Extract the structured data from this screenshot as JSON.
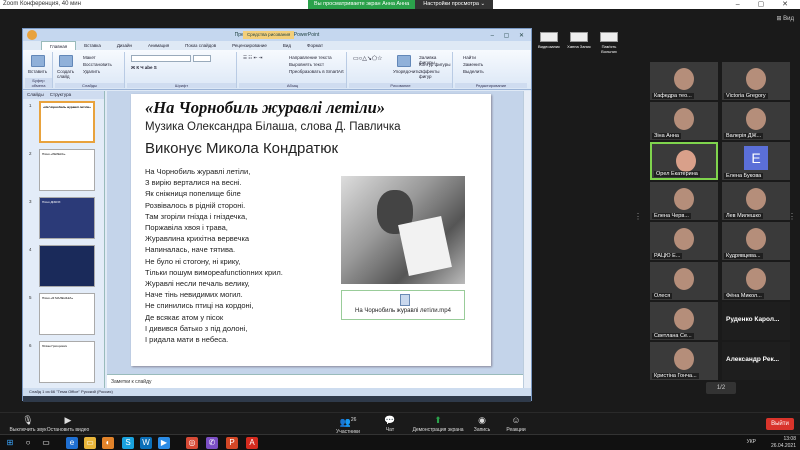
{
  "titlebar": {
    "title": "Zoom Конференция, 40 мин",
    "controls": "– ▢ ✕"
  },
  "share_banner": {
    "status": "Вы просматриваете экран Анна Анна",
    "options": "Настройки просмотра ⌄"
  },
  "view_label": "⊞ Вид",
  "ppt": {
    "window_title": "Презентация1 - Microsoft PowerPoint",
    "context_tab": "Средства рисования",
    "tabs": [
      "Главная",
      "Вставка",
      "Дизайн",
      "Анимация",
      "Показ слайдов",
      "Рецензирование",
      "Вид",
      "Формат"
    ],
    "ribbon": {
      "paste": "Вставить",
      "clipboard": "Буфер обмена",
      "create_slide": "Создать слайд",
      "layout": "Макет",
      "restore": "Восстановить",
      "delete": "Удалить",
      "slides_group": "Слайды",
      "font_group": "Шрифт",
      "paragraph_group": "Абзац",
      "text_dir": "Направление текста",
      "align_text": "Выровнять текст",
      "smartart": "Преобразовать в SmartArt",
      "drawing_group": "Рисование",
      "arrange": "Упорядочить",
      "quick_styles": "Экспресс-стили",
      "shape_fill": "Заливка фигуры",
      "shape_outline": "Контур фигуры",
      "shape_effects": "Эффекты фигур",
      "find": "Найти",
      "replace": "Заменить",
      "select": "Выделить",
      "editing_group": "Редактирование"
    },
    "panel_tabs": [
      "Слайды",
      "Структура"
    ],
    "slide_numbers": [
      "1",
      "2",
      "3",
      "4",
      "5",
      "6"
    ],
    "thumb_titles": [
      "«На Чорнобиль журавлі летіли»",
      "Пісня «ЛЕЛЕКА»",
      "Пісня ДИКИХ",
      "",
      "Пісня «Я МАЛЕНЬКА»",
      "Юліан Григорович"
    ],
    "slide": {
      "title": "«На Чорнобиль журавлі летіли»",
      "subtitle": "Музика Олександра Білаша, слова Д. Павличка",
      "performer": "Виконує Микола Кондратюк",
      "poem": [
        "На Чорнобиль журавлі летіли,",
        "З вирію верталися на весні.",
        "Як сніжниця попелище біле",
        "Розвівалось в рідній стороні.",
        "Там згоріли гнізда і гніздечка,",
        "Поржавіла хвоя і трава,",
        "Журавлина крихітна вервечка",
        "Напиналась, наче тятива.",
        "Не було ні стогону, ні крику,",
        "Тільки пошум вимореafunctionних крил.",
        "Журавлі несли печаль велику,",
        "Наче тінь невидимих могил.",
        "Не спинились птиці на кордоні,",
        "Де всякає атом у пісок",
        "І дивився батько з під долоні,",
        "І ридала мати в небеса."
      ],
      "media_file": "На Чорнобиль журавлі летіли.mp4"
    },
    "notes_placeholder": "Заметки к слайду",
    "status": "Слайд 1 из 66     \"Тема Office\"     Русский (Россия)",
    "clock": "13:08\n26.04.2021"
  },
  "desktop_icons": [
    "Видеозапис",
    "Ханна Запис",
    "Пам'ять Вольних"
  ],
  "participants": [
    {
      "name": "Кафедра тео...",
      "type": "video"
    },
    {
      "name": "Victoria Gregory",
      "type": "video"
    },
    {
      "name": "Зіна Анна",
      "type": "video"
    },
    {
      "name": "Валерія ДЖ...",
      "type": "video"
    },
    {
      "name": "Орел Екатерина",
      "type": "video",
      "active": true
    },
    {
      "name": "Елена Букова",
      "type": "avatar",
      "letter": "E"
    },
    {
      "name": "Елена Черв...",
      "type": "video"
    },
    {
      "name": "Лев Милешко",
      "type": "video"
    },
    {
      "name": "РАЦЮ Е...",
      "type": "video"
    },
    {
      "name": "Кудрявцева...",
      "type": "video"
    },
    {
      "name": "Олеся",
      "type": "video"
    },
    {
      "name": "Фёна Микол...",
      "type": "video"
    },
    {
      "name": "Светлана Се...",
      "type": "video"
    },
    {
      "name": "Руденко Карол...",
      "type": "text"
    },
    {
      "name": "Кристіна Гонча...",
      "type": "video"
    },
    {
      "name": "Александр Рек...",
      "type": "text"
    }
  ],
  "pager": "1/2",
  "zoom_controls": {
    "mute": "Выключить звук",
    "video": "Остановить видео",
    "participants": "Участники",
    "participants_count": "26",
    "chat": "Чат",
    "share": "Демонстрация экрана",
    "record": "Запись",
    "reactions": "Реакции",
    "leave": "Выйти"
  },
  "windows_tray": {
    "lang": "УКР",
    "time": "13:08",
    "date": "26.04.2021"
  },
  "colors": {
    "zoom_green": "#2ba14b",
    "leave_red": "#d9342b",
    "active_speaker": "#7fd44d"
  }
}
